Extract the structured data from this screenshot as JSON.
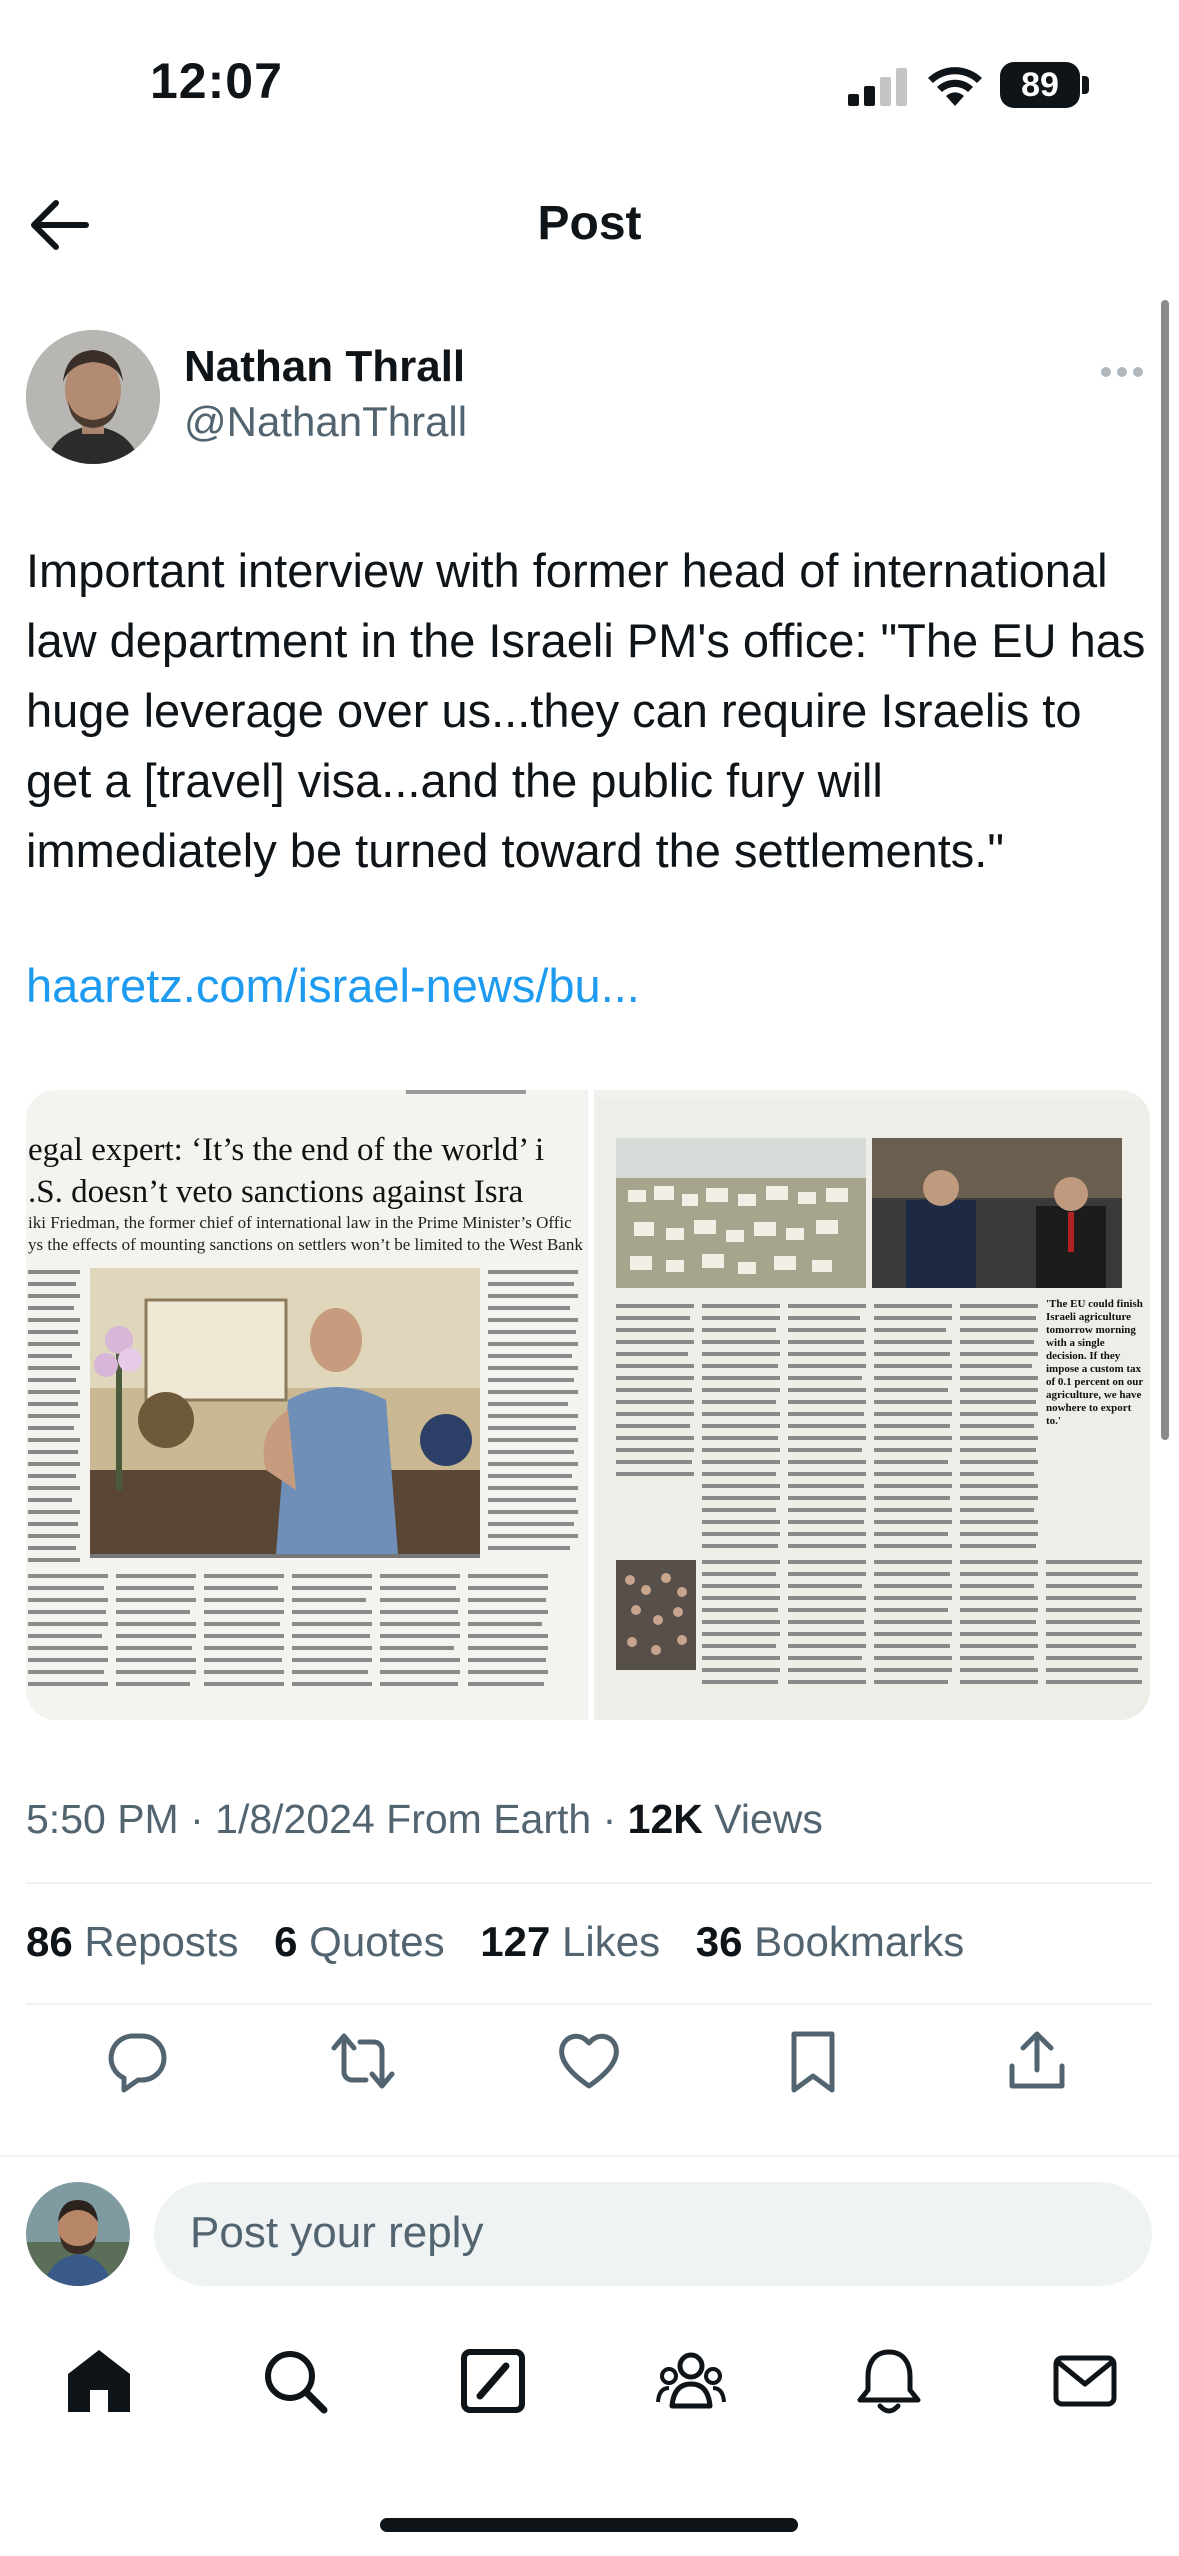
{
  "status_bar": {
    "time": "12:07",
    "battery": "89"
  },
  "header": {
    "title": "Post"
  },
  "author": {
    "name": "Nathan Thrall",
    "handle": "@NathanThrall"
  },
  "tweet": {
    "text": "Important interview with former head of international law department in the Israeli PM's office: \"The EU has huge leverage over us...they can require Israelis to get a [travel] visa...and the public fury will immediately be turned toward the settlements.\"",
    "link": "haaretz.com/israel-news/bu..."
  },
  "media": {
    "headline_1": "egal expert: ‘It’s the end of the world’ i",
    "headline_2": ".S. doesn’t veto sanctions against Isra",
    "subhead_1": "iki Friedman, the former chief of international law in the Prime Minister’s Offic",
    "subhead_2": "ys the effects of mounting sanctions on settlers won’t be limited to the West Bank",
    "pull_quote": "'The EU could finish Israeli agriculture tomorrow morning with a single decision. If they impose a custom tax of 0.1 percent on our agriculture, we have nowhere to export to.'"
  },
  "meta": {
    "time": "5:50 PM",
    "date": "1/8/2024",
    "source": "From Earth",
    "views_count": "12K",
    "views_label": "Views"
  },
  "stats": [
    {
      "count": "86",
      "label": "Reposts"
    },
    {
      "count": "6",
      "label": "Quotes"
    },
    {
      "count": "127",
      "label": "Likes"
    },
    {
      "count": "36",
      "label": "Bookmarks"
    }
  ],
  "reply": {
    "placeholder": "Post your reply"
  },
  "colors": {
    "link": "#1d9bf0",
    "secondary_text": "#536471",
    "divider": "#eff3f4",
    "text": "#0f1419"
  }
}
